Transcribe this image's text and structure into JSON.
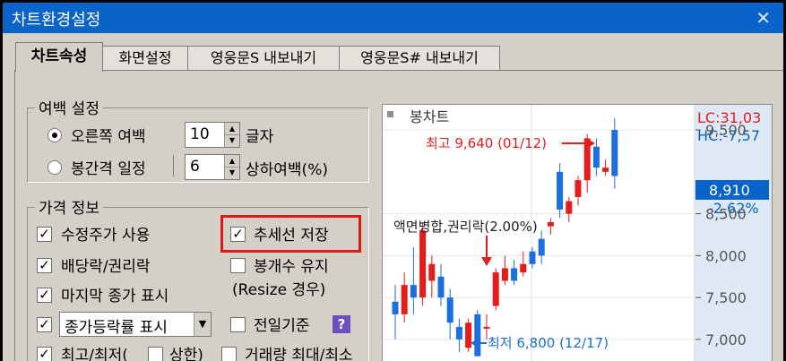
{
  "window": {
    "title": "차트환경설정",
    "close_glyph": "✕"
  },
  "tabs": [
    {
      "label": "차트속성",
      "active": true
    },
    {
      "label": "화면설정",
      "active": false
    },
    {
      "label": "영웅문S 내보내기",
      "active": false
    },
    {
      "label": "영웅문S# 내보내기",
      "active": false
    }
  ],
  "margin_settings": {
    "legend": "여백 설정",
    "right_margin": {
      "label": "오른쪽 여백",
      "value": "10",
      "unit": "글자",
      "selected": true
    },
    "candle_gap": {
      "label": "봉간격 일정",
      "value": "6",
      "unit": "상하여백(%)",
      "selected": false
    }
  },
  "price_info": {
    "legend": "가격 정보",
    "adjusted_price": {
      "label": "수정주가 사용",
      "checked": true
    },
    "trendline_save": {
      "label": "추세선 저장",
      "checked": true
    },
    "dividend": {
      "label": "배당락/권리락",
      "checked": true
    },
    "keep_candles": {
      "label": "봉개수 유지",
      "checked": false
    },
    "resize_note": "(Resize 경우)",
    "last_close": {
      "label": "마지막 종가 표시",
      "checked": true
    },
    "prev_day_base": {
      "label": "전일기준",
      "checked": false
    },
    "change_rate": {
      "checked": true,
      "value": "종가등락률 표시"
    },
    "high_low": {
      "label": "최고/최저(",
      "checked": true
    },
    "upper_limit": {
      "label": "상한)",
      "checked": false
    },
    "volume_maxmin": {
      "label": "거래량 최대/최소",
      "checked": false
    },
    "help_glyph": "?"
  },
  "preview": {
    "series_label": "봉차트",
    "lc": "LC:31,03",
    "hc": "HC:-7,57",
    "annotation_high": "최고 9,640 (01/12)",
    "annotation_low": "최저 6,800 (12/17)",
    "annotation_event": "액면병합,권리락(2.00%)",
    "last_price": "8,910",
    "last_change": "-2.62%",
    "axis_labels": [
      "9,500",
      "8,500",
      "8,000",
      "7,500",
      "7,000"
    ],
    "colors": {
      "up": "#e51c1c",
      "down": "#1c6fe0",
      "accent": "#0a63c8"
    }
  },
  "chart_data": {
    "type": "bar",
    "ylim": [
      6700,
      9800
    ],
    "candles": [
      {
        "o": 7450,
        "c": 7300,
        "h": 7650,
        "l": 7000
      },
      {
        "o": 7300,
        "c": 7650,
        "h": 7800,
        "l": 7200
      },
      {
        "o": 7650,
        "c": 7500,
        "h": 8100,
        "l": 7300
      },
      {
        "o": 7500,
        "c": 8300,
        "h": 8400,
        "l": 7400
      },
      {
        "o": 7700,
        "c": 7900,
        "h": 8000,
        "l": 7500
      },
      {
        "o": 7750,
        "c": 7500,
        "h": 7900,
        "l": 7400
      },
      {
        "o": 7500,
        "c": 7200,
        "h": 7600,
        "l": 7000
      },
      {
        "o": 7150,
        "c": 7000,
        "h": 7250,
        "l": 6850
      },
      {
        "o": 6900,
        "c": 7200,
        "h": 7250,
        "l": 6850
      },
      {
        "o": 7300,
        "c": 6800,
        "h": 7350,
        "l": 6800
      },
      {
        "o": 7150,
        "c": 7150,
        "h": 7300,
        "l": 7000
      },
      {
        "o": 7400,
        "c": 7800,
        "h": 7850,
        "l": 7350
      },
      {
        "o": 7700,
        "c": 7850,
        "h": 8000,
        "l": 7650
      },
      {
        "o": 7850,
        "c": 7700,
        "h": 7950,
        "l": 7650
      },
      {
        "o": 7800,
        "c": 7900,
        "h": 8050,
        "l": 7750
      },
      {
        "o": 8050,
        "c": 7900,
        "h": 8100,
        "l": 7850
      },
      {
        "o": 8200,
        "c": 8000,
        "h": 8300,
        "l": 7900
      },
      {
        "o": 8350,
        "c": 8400,
        "h": 8450,
        "l": 8250
      },
      {
        "o": 9000,
        "c": 8550,
        "h": 9100,
        "l": 8450
      },
      {
        "o": 8500,
        "c": 8650,
        "h": 8700,
        "l": 8400
      },
      {
        "o": 8700,
        "c": 8900,
        "h": 8950,
        "l": 8600
      },
      {
        "o": 8900,
        "c": 9400,
        "h": 9450,
        "l": 8750
      },
      {
        "o": 9300,
        "c": 9050,
        "h": 9400,
        "l": 8950
      },
      {
        "o": 9000,
        "c": 9050,
        "h": 9150,
        "l": 8950
      },
      {
        "o": 9500,
        "c": 8950,
        "h": 9640,
        "l": 8800
      }
    ]
  }
}
